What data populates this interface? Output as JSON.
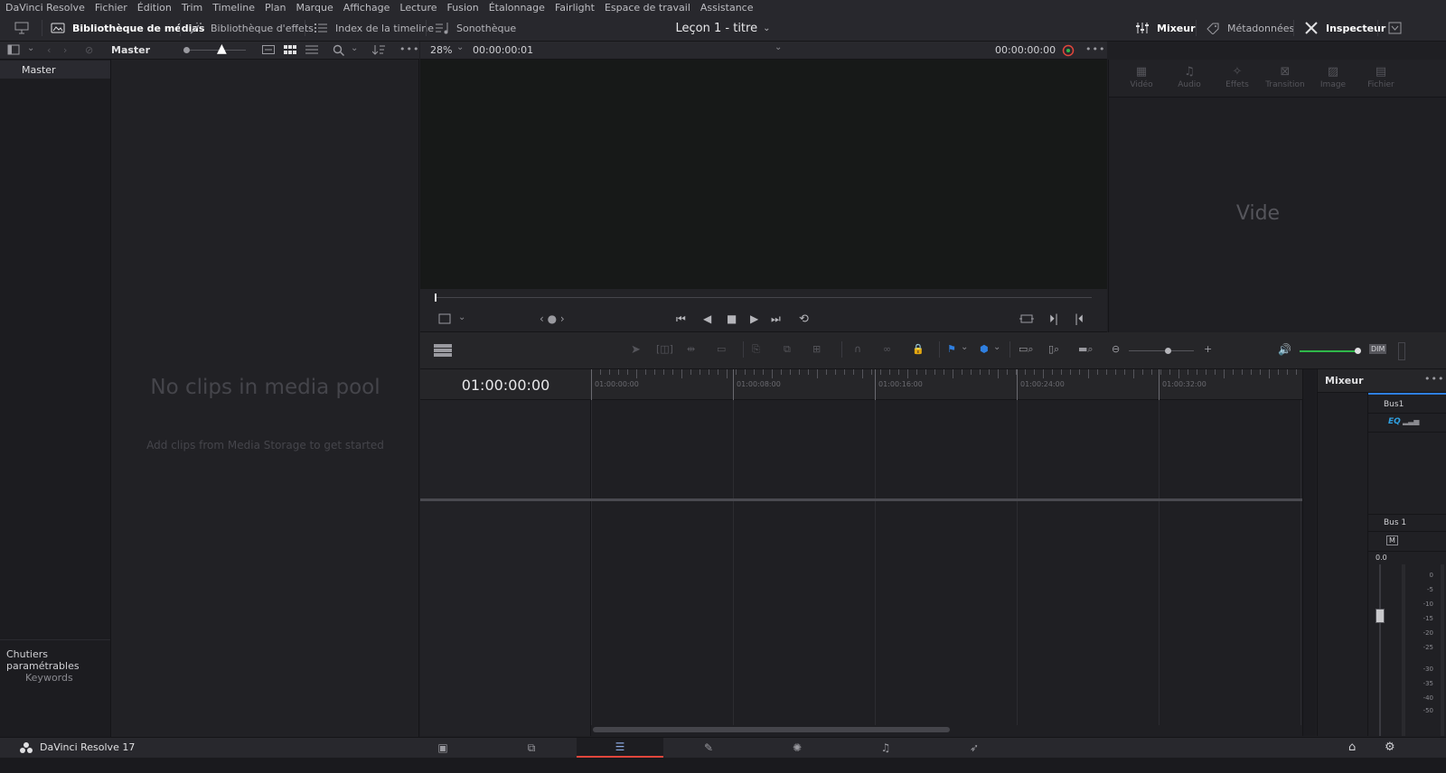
{
  "menu": [
    "DaVinci Resolve",
    "Fichier",
    "Édition",
    "Trim",
    "Timeline",
    "Plan",
    "Marque",
    "Affichage",
    "Lecture",
    "Fusion",
    "Étalonnage",
    "Fairlight",
    "Espace de travail",
    "Assistance"
  ],
  "toolbar": {
    "media_pool": "Bibliothèque de médias",
    "effects": "Bibliothèque d'effets",
    "edit_index": "Index de la timeline",
    "sound_library": "Sonothèque",
    "project_title": "Leçon 1 - titre",
    "mixer": "Mixeur",
    "metadata": "Métadonnées",
    "inspector": "Inspecteur"
  },
  "media_pool": {
    "bin_label": "Master",
    "sidebar_master": "Master",
    "empty_title": "No clips in media pool",
    "empty_subtitle": "Add clips from Media Storage to get started",
    "smart_bins": "Chutiers paramétrables",
    "keywords": "Keywords"
  },
  "viewer": {
    "zoom": "28%",
    "source_timecode": "00:00:00:01",
    "timecode": "00:00:00:00"
  },
  "inspector": {
    "tabs": [
      "Vidéo",
      "Audio",
      "Effets",
      "Transition",
      "Image",
      "Fichier"
    ],
    "empty": "Vide"
  },
  "timeline": {
    "timecode": "01:00:00:00",
    "ruler_labels": [
      "01:00:00:00",
      "01:00:08:00",
      "01:00:16:00",
      "01:00:24:00",
      "01:00:32:00"
    ]
  },
  "mixer": {
    "title": "Mixeur",
    "bus_top": "Bus1",
    "eq": "EQ",
    "bus_label": "Bus 1",
    "mute": "M",
    "fader_value": "0.0",
    "scale": [
      "0",
      "-5",
      "-10",
      "-15",
      "-20",
      "-25",
      "-30",
      "-35",
      "-40",
      "-50"
    ],
    "dim": "DIM"
  },
  "footer": {
    "app_name": "DaVinci Resolve 17"
  },
  "colors": {
    "accent_red": "#e2463c",
    "blue": "#2f7fe0",
    "green": "#2fb84a"
  }
}
